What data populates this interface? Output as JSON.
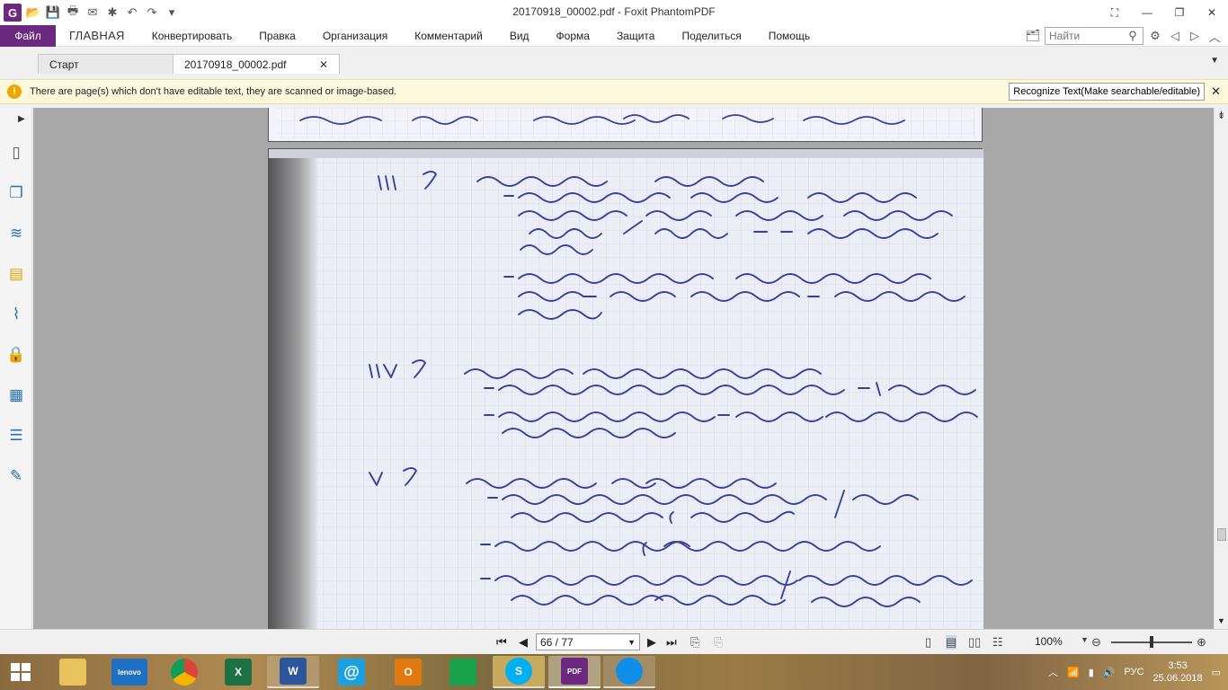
{
  "window": {
    "title": "20170918_00002.pdf - Foxit PhantomPDF"
  },
  "quick_access": {
    "icons": [
      "foxit-logo-icon",
      "open-folder-icon",
      "save-icon",
      "print-icon",
      "email-icon",
      "new-icon",
      "undo-icon",
      "redo-icon",
      "customize-icon"
    ],
    "logo_letter": "G"
  },
  "menu": {
    "file": "Файл",
    "items": [
      "ГЛАВНАЯ",
      "Конвертировать",
      "Правка",
      "Организация",
      "Комментарий",
      "Вид",
      "Форма",
      "Защита",
      "Поделиться",
      "Помощь"
    ],
    "search_placeholder": "Найти"
  },
  "tabs": [
    {
      "label": "Старт"
    },
    {
      "label": "20170918_00002.pdf"
    }
  ],
  "notice": {
    "text": "There are page(s) which don't have editable text, they are scanned or image-based.",
    "button": "Recognize Text(Make searchable/editable)"
  },
  "statusbar": {
    "page": "66 / 77",
    "zoom": "100%"
  },
  "taskbar": {
    "apps": [
      {
        "name": "file-explorer",
        "label": ""
      },
      {
        "name": "lenovo",
        "label": "lenovo"
      },
      {
        "name": "chrome",
        "label": ""
      },
      {
        "name": "excel",
        "label": "X"
      },
      {
        "name": "word",
        "label": "W"
      },
      {
        "name": "mail",
        "label": "@"
      },
      {
        "name": "outlook",
        "label": "O"
      },
      {
        "name": "store",
        "label": ""
      },
      {
        "name": "skype",
        "label": "S"
      },
      {
        "name": "foxit",
        "label": "PDF"
      },
      {
        "name": "teamviewer",
        "label": ""
      }
    ],
    "lang": "РУС",
    "time": "3:53",
    "date": "25.06.2018"
  },
  "colors": {
    "accent": "#6b2a80",
    "notice_bg": "#fcf8dc",
    "ink": "#3b3f9a"
  }
}
